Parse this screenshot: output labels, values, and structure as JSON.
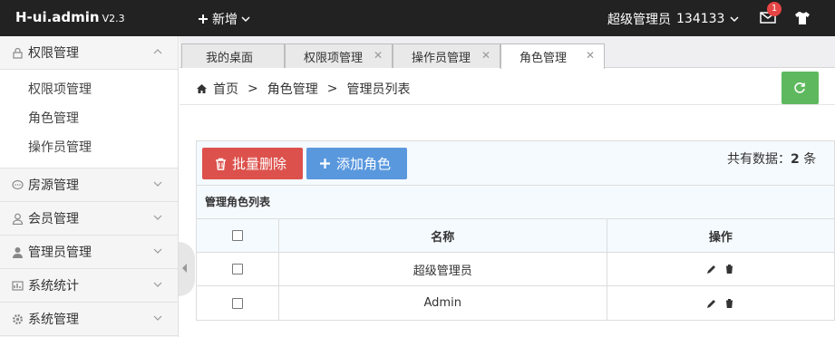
{
  "header": {
    "logo": "H-ui.admin",
    "version": "V2.3",
    "new_label": "新增",
    "user_name": "超级管理员",
    "user_id": "134133",
    "mail_badge": "1"
  },
  "sidebar": {
    "groups": [
      {
        "label": "权限管理",
        "icon": "lock-icon",
        "expanded": true,
        "items": [
          "权限项管理",
          "角色管理",
          "操作员管理"
        ]
      },
      {
        "label": "房源管理",
        "icon": "chat-icon"
      },
      {
        "label": "会员管理",
        "icon": "user-icon"
      },
      {
        "label": "管理员管理",
        "icon": "admin-icon"
      },
      {
        "label": "系统统计",
        "icon": "stats-icon"
      },
      {
        "label": "系统管理",
        "icon": "gear-icon"
      }
    ]
  },
  "tabs": [
    {
      "label": "我的桌面",
      "closable": false
    },
    {
      "label": "权限项管理",
      "closable": true
    },
    {
      "label": "操作员管理",
      "closable": true
    },
    {
      "label": "角色管理",
      "closable": true,
      "active": true
    }
  ],
  "breadcrumb": {
    "home": "首页",
    "sep": ">",
    "level1": "角色管理",
    "level2": "管理员列表"
  },
  "toolbar": {
    "batch_delete": "批量删除",
    "add_role": "添加角色",
    "count_prefix": "共有数据：",
    "count": "2",
    "count_suffix": "条"
  },
  "table": {
    "caption": "管理角色列表",
    "headers": [
      "名称",
      "操作"
    ],
    "rows": [
      {
        "name": "超级管理员"
      },
      {
        "name": "Admin"
      }
    ]
  },
  "colors": {
    "topbar": "#222222",
    "danger": "#dd514c",
    "primary": "#5a98de",
    "success": "#5eb95e",
    "badge": "#e64545"
  }
}
